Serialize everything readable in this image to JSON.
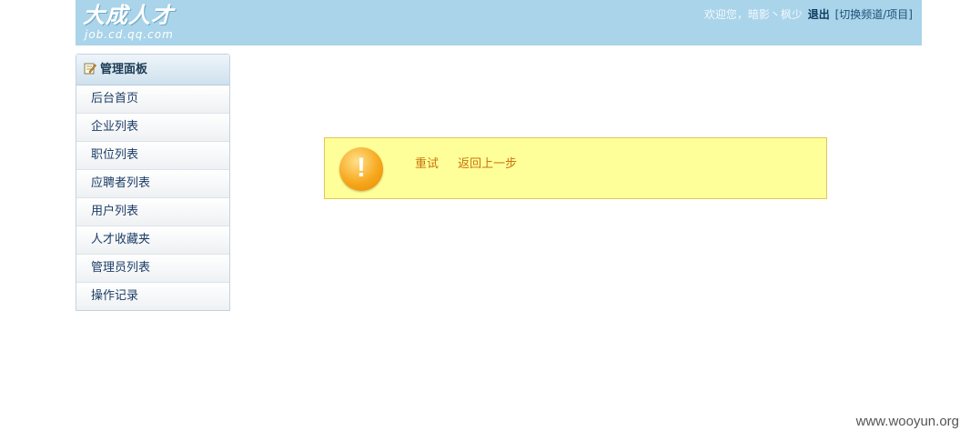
{
  "header": {
    "logo_text": "大成人才",
    "logo_domain": "job.cd.qq.com",
    "welcome_text": "欢迎您，暗影丶枫少",
    "logout_label": "退出",
    "switch_label": "[切换频道/项目]"
  },
  "sidebar": {
    "title": "管理面板",
    "items": [
      {
        "label": "后台首页"
      },
      {
        "label": "企业列表"
      },
      {
        "label": "职位列表"
      },
      {
        "label": "应聘者列表"
      },
      {
        "label": "用户列表"
      },
      {
        "label": "人才收藏夹"
      },
      {
        "label": "管理员列表"
      },
      {
        "label": "操作记录"
      }
    ]
  },
  "message": {
    "icon": "warning-icon",
    "icon_glyph": "!",
    "retry_label": "重试",
    "back_label": "返回上一步"
  },
  "watermark": "www.wooyun.org",
  "colors": {
    "header_bg": "#a9d4ea",
    "message_bg": "#ffff99",
    "message_border": "#e3c65a",
    "link_color": "#c9730c",
    "warning_orange": "#f7a81e"
  }
}
